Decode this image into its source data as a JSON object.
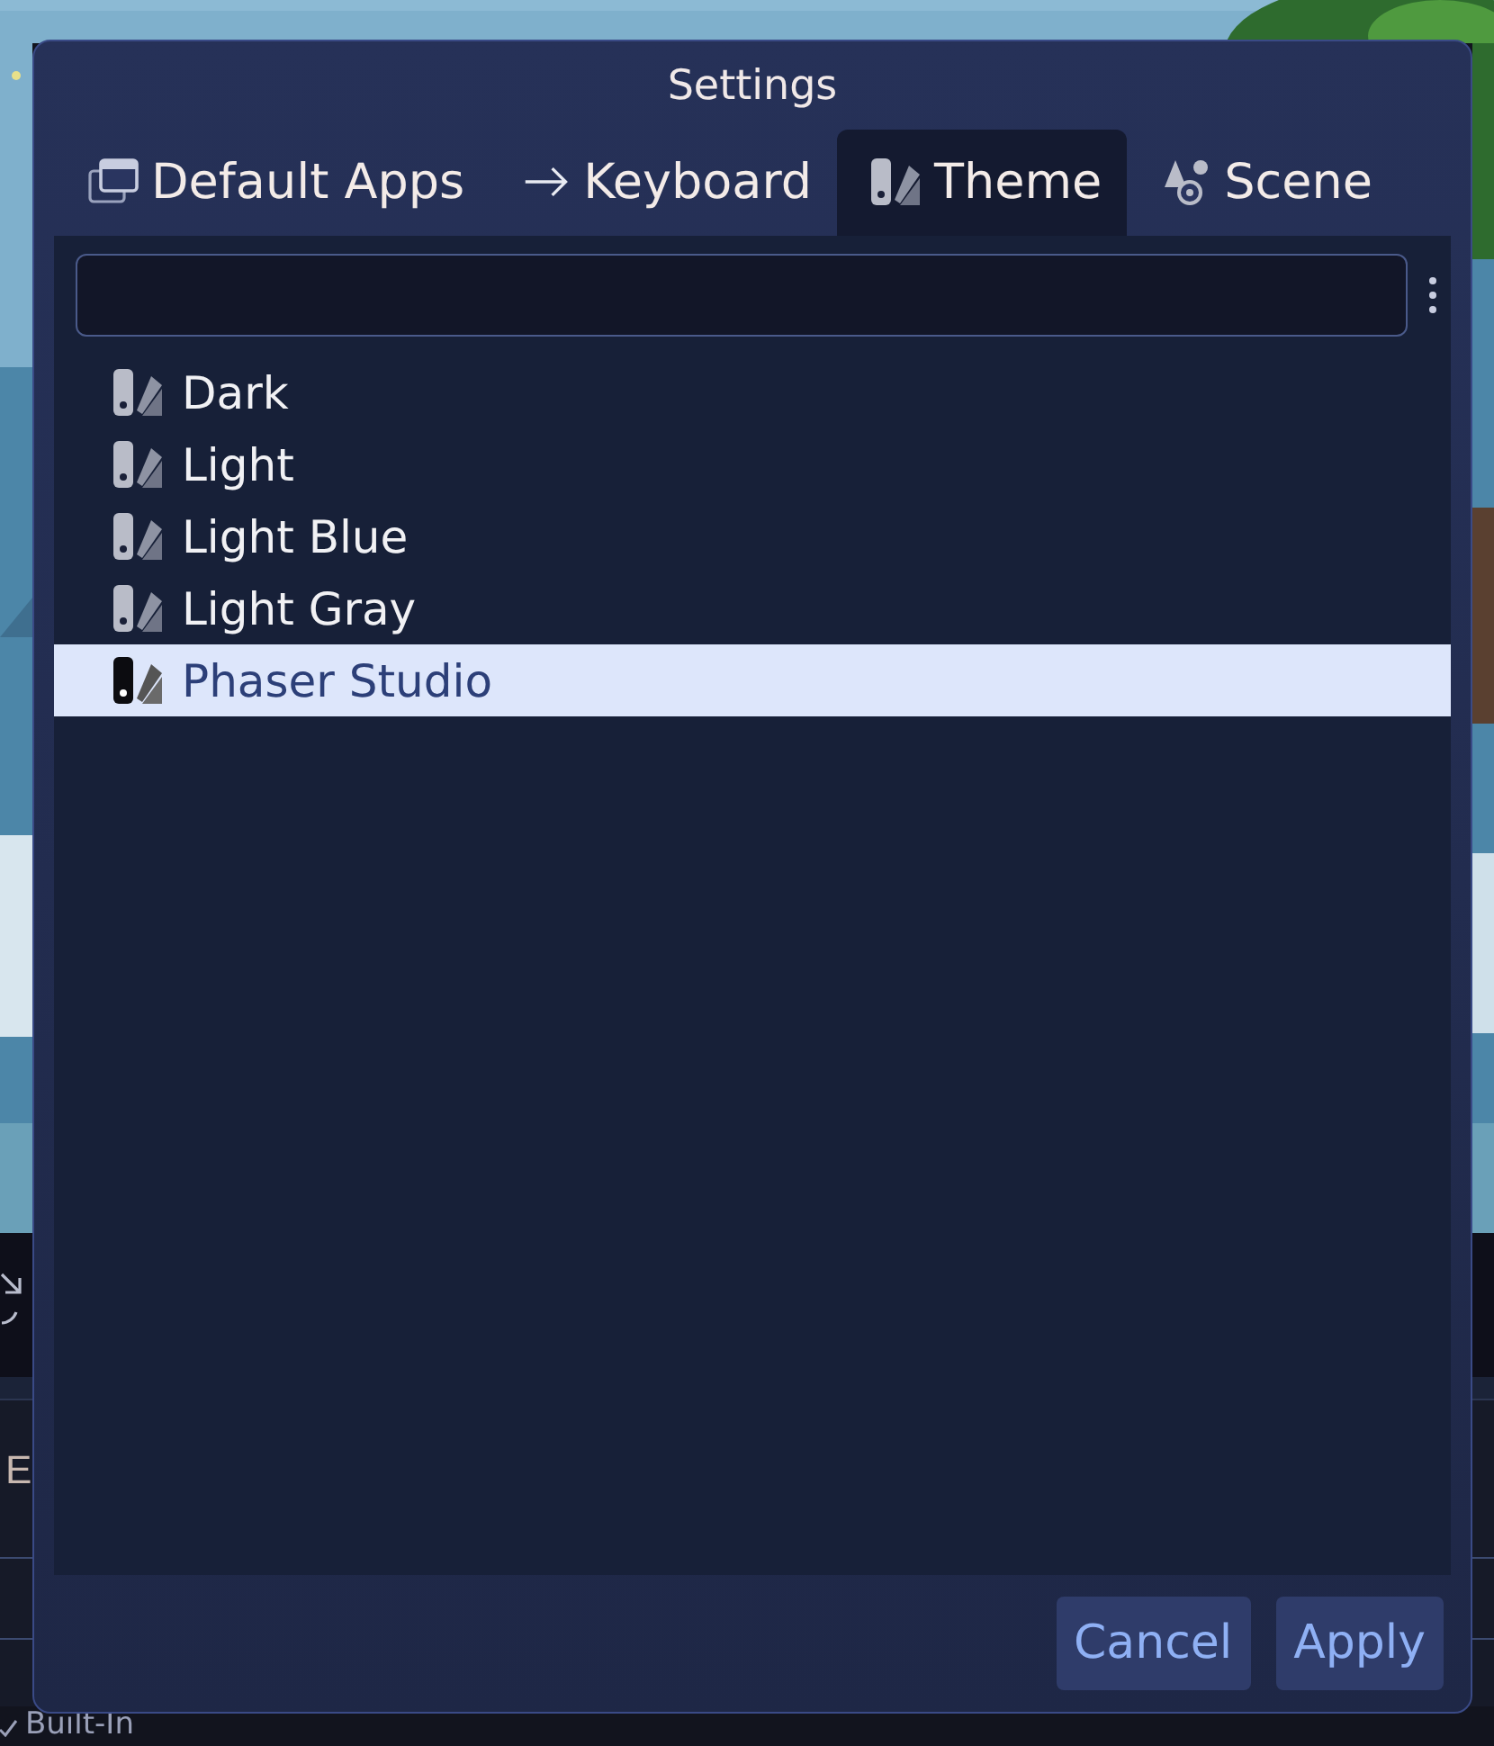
{
  "behind": {
    "panel_text": "E",
    "filter_label": "Built-In"
  },
  "dialog": {
    "title": "Settings",
    "tabs": [
      {
        "label": "Default Apps",
        "selected": false
      },
      {
        "label": "Keyboard",
        "selected": false
      },
      {
        "label": "Theme",
        "selected": true
      },
      {
        "label": "Scene",
        "selected": false
      }
    ],
    "themes": [
      {
        "label": "Dark",
        "selected": false
      },
      {
        "label": "Light",
        "selected": false
      },
      {
        "label": "Light Blue",
        "selected": false
      },
      {
        "label": "Light Gray",
        "selected": false
      },
      {
        "label": "Phaser Studio",
        "selected": true
      }
    ],
    "buttons": [
      "Cancel",
      "Apply"
    ]
  }
}
